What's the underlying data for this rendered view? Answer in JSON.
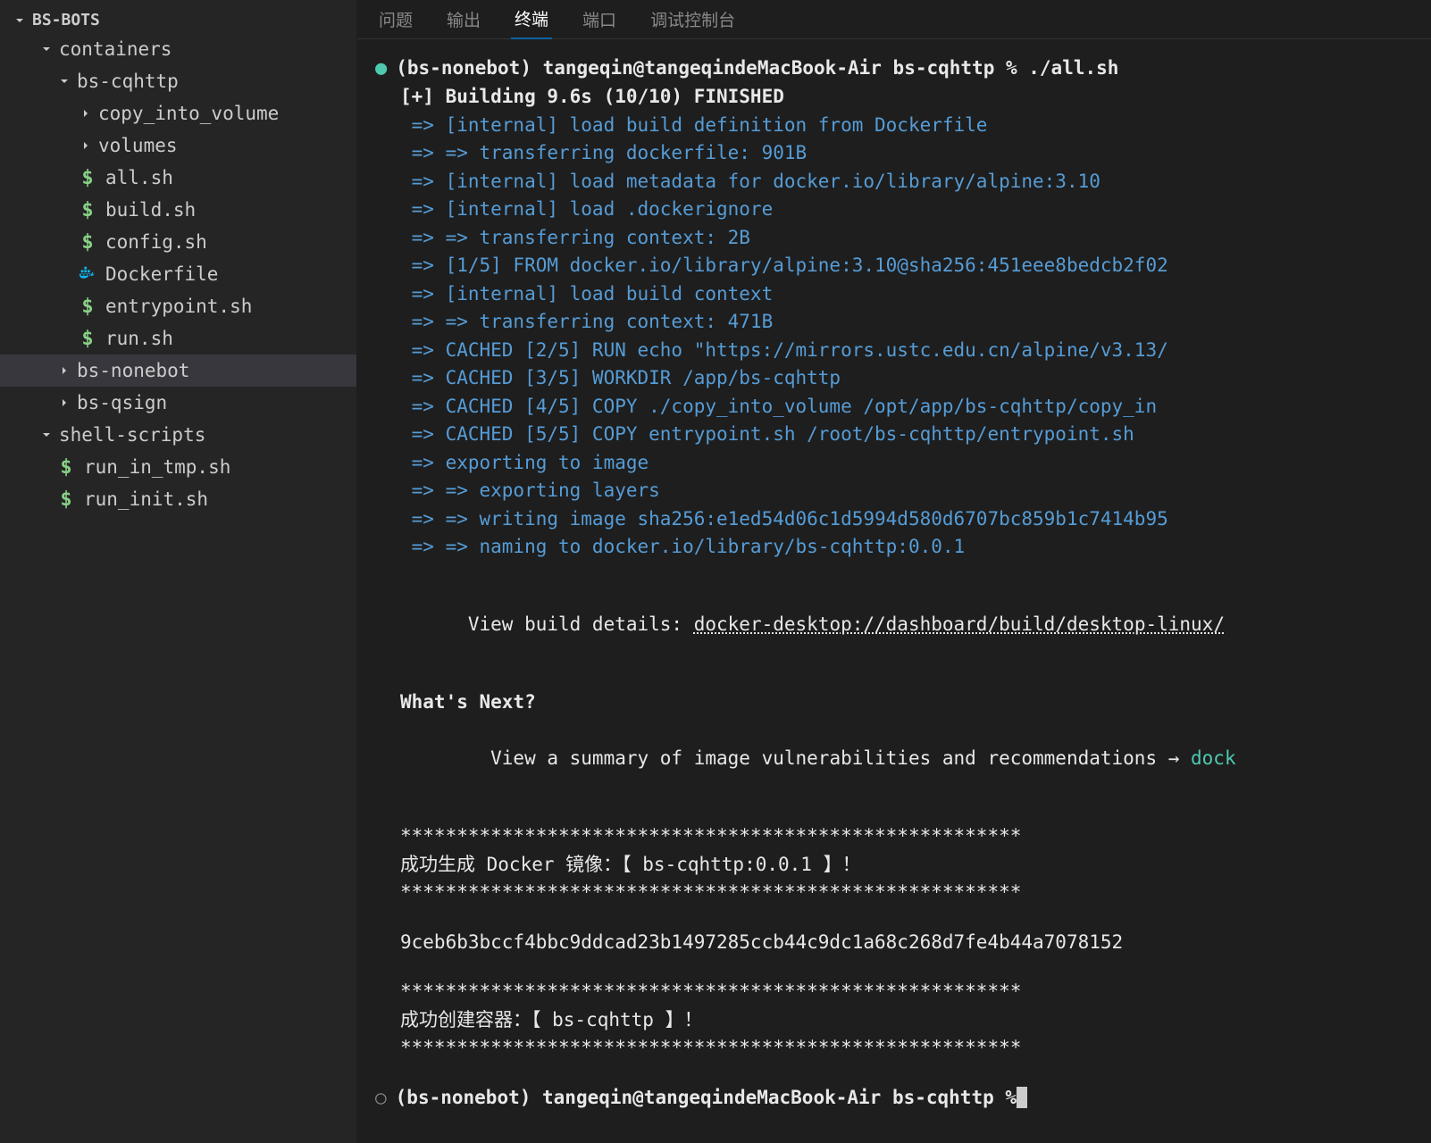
{
  "project": {
    "name": "BS-BOTS"
  },
  "tree": [
    {
      "label": "containers",
      "type": "folder",
      "open": true,
      "indent": 1
    },
    {
      "label": "bs-cqhttp",
      "type": "folder",
      "open": true,
      "indent": 2
    },
    {
      "label": "copy_into_volume",
      "type": "folder",
      "open": false,
      "indent": 3
    },
    {
      "label": "volumes",
      "type": "folder",
      "open": false,
      "indent": 3
    },
    {
      "label": "all.sh",
      "type": "sh",
      "indent": 3
    },
    {
      "label": "build.sh",
      "type": "sh",
      "indent": 3
    },
    {
      "label": "config.sh",
      "type": "sh",
      "indent": 3
    },
    {
      "label": "Dockerfile",
      "type": "docker",
      "indent": 3
    },
    {
      "label": "entrypoint.sh",
      "type": "sh",
      "indent": 3
    },
    {
      "label": "run.sh",
      "type": "sh",
      "indent": 3
    },
    {
      "label": "bs-nonebot",
      "type": "folder",
      "open": false,
      "indent": 2,
      "selected": true
    },
    {
      "label": "bs-qsign",
      "type": "folder",
      "open": false,
      "indent": 2
    },
    {
      "label": "shell-scripts",
      "type": "folder",
      "open": true,
      "indent": 1
    },
    {
      "label": "run_in_tmp.sh",
      "type": "sh",
      "indent": 2
    },
    {
      "label": "run_init.sh",
      "type": "sh",
      "indent": 2
    }
  ],
  "tabs": {
    "items": [
      "问题",
      "输出",
      "终端",
      "端口",
      "调试控制台"
    ],
    "activeIndex": 2
  },
  "terminal": {
    "prompt1": "(bs-nonebot) tangeqin@tangeqindeMacBook-Air bs-cqhttp % ./all.sh",
    "building": "[+] Building 9.6s (10/10) FINISHED",
    "steps": [
      " => [internal] load build definition from Dockerfile",
      " => => transferring dockerfile: 901B",
      " => [internal] load metadata for docker.io/library/alpine:3.10",
      " => [internal] load .dockerignore",
      " => => transferring context: 2B",
      " => [1/5] FROM docker.io/library/alpine:3.10@sha256:451eee8bedcb2f02",
      " => [internal] load build context",
      " => => transferring context: 471B",
      " => CACHED [2/5] RUN echo \"https://mirrors.ustc.edu.cn/alpine/v3.13/",
      " => CACHED [3/5] WORKDIR /app/bs-cqhttp",
      " => CACHED [4/5] COPY ./copy_into_volume /opt/app/bs-cqhttp/copy_in",
      " => CACHED [5/5] COPY entrypoint.sh /root/bs-cqhttp/entrypoint.sh",
      " => exporting to image",
      " => => exporting layers",
      " => => writing image sha256:e1ed54d06c1d5994d580d6707bc859b1c7414b95",
      " => => naming to docker.io/library/bs-cqhttp:0.0.1"
    ],
    "view_details_label": "View build details: ",
    "view_details_link": "docker-desktop://dashboard/build/desktop-linux/",
    "whats_next": "What's Next?",
    "summary_label": "  View a summary of image vulnerabilities and recommendations → ",
    "summary_link": "dock",
    "stars1": "*******************************************************",
    "success_image": "成功生成 Docker 镜像：【 bs-cqhttp:0.0.1 】！",
    "stars2": "*******************************************************",
    "hash": "9ceb6b3bccf4bbc9ddcad23b1497285ccb44c9dc1a68c268d7fe4b44a7078152",
    "stars3": "*******************************************************",
    "success_container": "成功创建容器：【 bs-cqhttp 】！",
    "stars4": "*******************************************************",
    "prompt2": "(bs-nonebot) tangeqin@tangeqindeMacBook-Air bs-cqhttp % "
  }
}
